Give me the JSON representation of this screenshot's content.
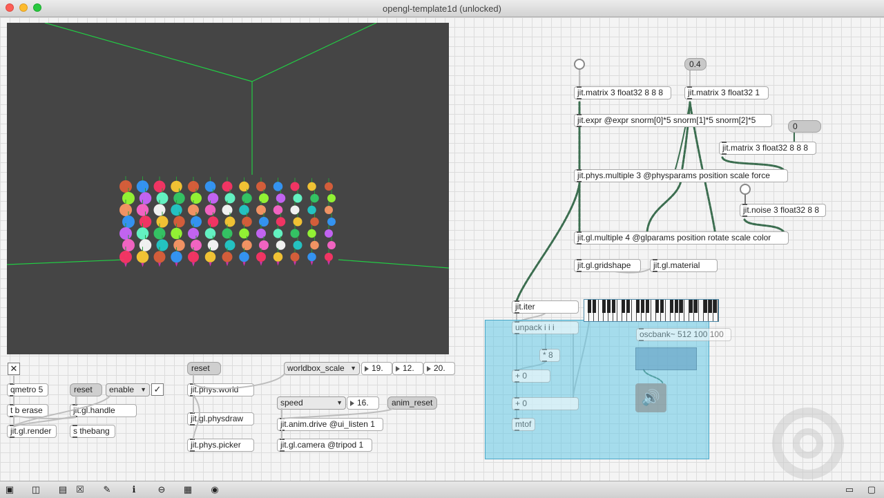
{
  "window": {
    "title": "opengl-template1d (unlocked)"
  },
  "render": {
    "toggle_symbol": "✕",
    "qmetro": "qmetro 5",
    "t_b_erase": "t b erase",
    "jit_gl_render": "jit.gl.render",
    "reset_msg": "reset",
    "enable_menu": "enable",
    "enable_checked": "✓",
    "jit_gl_handle": "jit.gl.handle",
    "s_thebang": "s thebang"
  },
  "physics": {
    "reset_msg": "reset",
    "jit_phys_world": "jit.phys.world",
    "jit_gl_physdraw": "jit.gl.physdraw",
    "jit_phys_picker": "jit.phys.picker",
    "worldbox_menu": "worldbox_scale",
    "worldbox_values": [
      "19.",
      "12.",
      "20."
    ]
  },
  "animation": {
    "speed_menu": "speed",
    "speed_value": "16.",
    "anim_reset_msg": "anim_reset",
    "jit_anim_drive": "jit.anim.drive @ui_listen 1",
    "jit_gl_camera": "jit.gl.camera @tripod 1"
  },
  "matrix": {
    "float_04": "0.4",
    "float_0": "0",
    "matrix_888": "jit.matrix 3 float32 8 8 8",
    "matrix_1": "jit.matrix 3 float32 1",
    "expr": "jit.expr @expr snorm[0]*5 snorm[1]*5 snorm[2]*5",
    "matrix_888_b": "jit.matrix 3 float32 8 8 8",
    "phys_multiple": "jit.phys.multiple 3 @physparams position scale force",
    "noise": "jit.noise 3 float32 8 8",
    "gl_multiple": "jit.gl.multiple 4 @glparams position rotate scale color",
    "gridshape": "jit.gl.gridshape",
    "material": "jit.gl.material"
  },
  "audio": {
    "jit_iter": "jit.iter",
    "unpack": "unpack i i i",
    "times8": "* 8",
    "plus0a": "+ 0",
    "plus0b": "+ 0",
    "mtof": "mtof",
    "oscbank": "oscbank~ 512 100 100",
    "speaker_glyph": "🔊"
  },
  "toolbar_icons": [
    "lock-icon",
    "copy-icon",
    "presentation-icon",
    "clear-icon",
    "edit-icon",
    "info-icon",
    "connect-icon",
    "grid-icon",
    "snapshot-icon",
    "split-icon",
    "window-icon"
  ],
  "colors": {
    "patch_cord": "#3c6e50",
    "panel_fill": "#64c8e6",
    "grid_line": "#22cc44"
  }
}
